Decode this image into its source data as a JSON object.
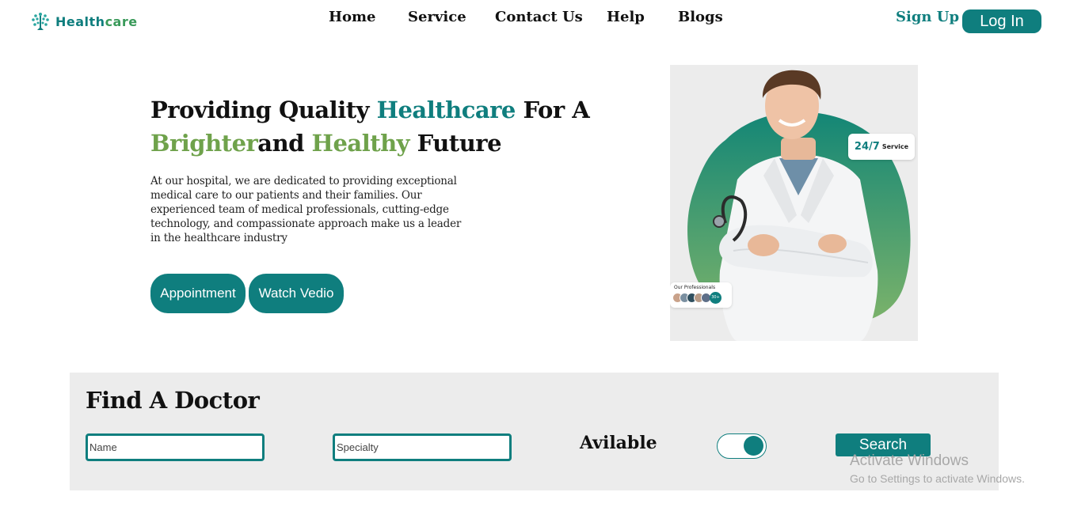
{
  "brand": {
    "name_part1": "Health",
    "name_part2": "care"
  },
  "nav": {
    "items": [
      {
        "label": "Home"
      },
      {
        "label": "Service"
      },
      {
        "label": "Contact Us"
      },
      {
        "label": "Help"
      },
      {
        "label": "Blogs"
      }
    ],
    "signup_label": "Sign Up",
    "login_label": "Log In"
  },
  "hero": {
    "title_1": "Providing Quality ",
    "title_2": "Healthcare",
    "title_3": " For A",
    "title_4": "Brighter",
    "title_5": "and ",
    "title_6": "Healthy",
    "title_7": " Future",
    "description": "At our hospital, we are dedicated to providing exceptional medical care to our patients and their families. Our experienced team of medical professionals, cutting-edge technology, and compassionate approach make us a leader in the healthcare industry",
    "appointment_label": "Appointment",
    "watch_label": "Watch Vedio",
    "badge_247_big": "24/7",
    "badge_247_small": "Service",
    "professionals_label": "Our Professionals",
    "professionals_count": "30+"
  },
  "find": {
    "title": "Find A Doctor",
    "name_placeholder": "Name",
    "specialty_placeholder": "Specialty",
    "available_label": "Avilable",
    "search_label": "Search",
    "available_on": true
  },
  "watermark": {
    "line1": "Activate Windows",
    "line2": "Go to Settings to activate Windows."
  },
  "colors": {
    "teal": "#0f7e7e",
    "green": "#6fa24b",
    "panel": "#ececec"
  }
}
